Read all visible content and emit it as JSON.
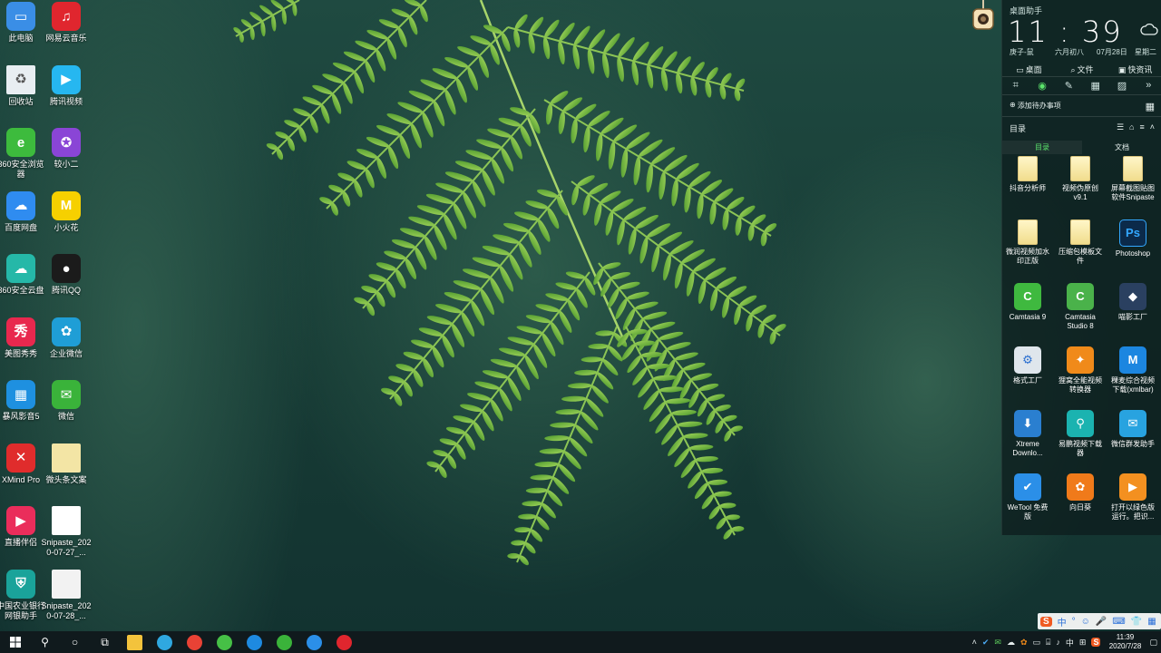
{
  "desktop": {
    "icons": [
      {
        "label": "此电脑",
        "color": "#3a8ee6",
        "glyph": "▭",
        "icon": "computer-icon"
      },
      {
        "label": "网易云音乐",
        "color": "#e0262e",
        "glyph": "♫",
        "icon": "netease-music-icon"
      },
      {
        "label": "回收站",
        "color": "#e8eef2",
        "glyph": "♻",
        "icon": "recycle-bin-icon"
      },
      {
        "label": "腾讯视频",
        "color": "#26b7f0",
        "glyph": "▶",
        "icon": "tencent-video-icon"
      },
      {
        "label": "360安全浏览器",
        "color": "#3dbb3d",
        "glyph": "e",
        "icon": "360-browser-icon"
      },
      {
        "label": "较小二",
        "color": "#8a45d6",
        "glyph": "✪",
        "icon": "jiaoxiaoer-icon"
      },
      {
        "label": "百度网盘",
        "color": "#2f8cf0",
        "glyph": "☁",
        "icon": "baidu-netdisk-icon"
      },
      {
        "label": "小火花",
        "color": "#f6d000",
        "glyph": "M",
        "icon": "xiaohuohua-icon"
      },
      {
        "label": "360安全云盘",
        "color": "#25b8a8",
        "glyph": "☁",
        "icon": "360-cloud-icon"
      },
      {
        "label": "腾讯QQ",
        "color": "#1b1b1b",
        "glyph": "●",
        "icon": "qq-icon"
      },
      {
        "label": "美图秀秀",
        "color": "#e8284e",
        "glyph": "秀",
        "icon": "meitu-icon"
      },
      {
        "label": "企业微信",
        "color": "#1f9ed6",
        "glyph": "✿",
        "icon": "wecom-icon"
      },
      {
        "label": "暴风影音5",
        "color": "#1e90e0",
        "glyph": "▦",
        "icon": "baofeng-icon"
      },
      {
        "label": "微信",
        "color": "#3ab33a",
        "glyph": "✉",
        "icon": "wechat-icon"
      },
      {
        "label": "XMind Pro",
        "color": "#e02c2c",
        "glyph": "✕",
        "icon": "xmind-icon"
      },
      {
        "label": "微头条文案",
        "color": "#f3e5a5",
        "glyph": "",
        "icon": "file-icon"
      },
      {
        "label": "直播伴侣",
        "color": "#ea2d5b",
        "glyph": "▶",
        "icon": "live-companion-icon"
      },
      {
        "label": "Snipaste_2020-07-27_...",
        "color": "#ffffff",
        "glyph": "",
        "icon": "image-file-icon"
      },
      {
        "label": "中国农业银行网银助手",
        "color": "#1aa39a",
        "glyph": "⛨",
        "icon": "abc-bank-icon"
      },
      {
        "label": "Snipaste_2020-07-28_...",
        "color": "#f2f2f2",
        "glyph": "",
        "icon": "image-file-icon"
      }
    ]
  },
  "widget": {
    "title": "桌面助手",
    "time": "11 : 39",
    "lunar_year": "庚子-鼠",
    "lunar_date": "六月初八",
    "date": "07月28日",
    "weekday": "星期二",
    "tabs": [
      {
        "label": "桌面",
        "glyph": "▭"
      },
      {
        "label": "文件",
        "glyph": "⌕"
      },
      {
        "label": "快资讯",
        "glyph": "▣"
      }
    ],
    "tools": [
      "⌗",
      "◉",
      "✎",
      "▦",
      "▨",
      "»"
    ],
    "add_todo": "添加待办事项",
    "section_title": "目录",
    "subtabs": [
      "目录",
      "文档"
    ],
    "items": [
      {
        "label": "抖音分析师",
        "type": "folder"
      },
      {
        "label": "视频伪原创v9.1",
        "type": "folder"
      },
      {
        "label": "屏幕截图贴图软件Snipaste",
        "type": "folder"
      },
      {
        "label": "微润视频加水印正版",
        "type": "folder"
      },
      {
        "label": "压缩包模板文件",
        "type": "folder"
      },
      {
        "label": "Photoshop",
        "type": "app",
        "color": "#0b2a4a",
        "glyph": "Ps"
      },
      {
        "label": "Camtasia 9",
        "type": "app",
        "color": "#3fb93f",
        "glyph": "C"
      },
      {
        "label": "Camtasia Studio 8",
        "type": "app",
        "color": "#4ab24a",
        "glyph": "C"
      },
      {
        "label": "喵影工厂",
        "type": "app",
        "color": "#2a4060",
        "glyph": "◆"
      },
      {
        "label": "格式工厂",
        "type": "app",
        "color": "#dfe6ec",
        "glyph": "⚙"
      },
      {
        "label": "狸窝全能视频转换器",
        "type": "app",
        "color": "#f08a1a",
        "glyph": "✦"
      },
      {
        "label": "稞麦综合视频下载(xmlbar)",
        "type": "app",
        "color": "#1c86e0",
        "glyph": "M"
      },
      {
        "label": "Xtreme Downlo...",
        "type": "app",
        "color": "#2a7fd0",
        "glyph": "⬇"
      },
      {
        "label": "易鹏视频下载器",
        "type": "app",
        "color": "#1bb3b0",
        "glyph": "⚲"
      },
      {
        "label": "微信群发助手",
        "type": "app",
        "color": "#28a3e0",
        "glyph": "✉"
      },
      {
        "label": "WeTool 免费版",
        "type": "app",
        "color": "#2b8fe8",
        "glyph": "✔"
      },
      {
        "label": "向日葵",
        "type": "app",
        "color": "#f07a1a",
        "glyph": "✿"
      },
      {
        "label": "打开以绿色版运行。把识...",
        "type": "app",
        "color": "#f39020",
        "glyph": "▶"
      }
    ]
  },
  "taskbar": {
    "apps": [
      {
        "icon": "file-explorer-icon",
        "color": "#f3c33c"
      },
      {
        "icon": "edge-browser-icon",
        "color": "#2fa8e0"
      },
      {
        "icon": "chrome-icon",
        "color": "#e94235"
      },
      {
        "icon": "360-browser-icon",
        "color": "#46c046"
      },
      {
        "icon": "qq-browser-icon",
        "color": "#1e8ae0"
      },
      {
        "icon": "wechat-icon",
        "color": "#3ab33a"
      },
      {
        "icon": "wetool-icon",
        "color": "#2b8fe8"
      },
      {
        "icon": "netease-music-icon",
        "color": "#e0262e"
      }
    ],
    "ime_label": "中",
    "clock_time": "11:39",
    "clock_date": "2020/7/28"
  },
  "ime_toolbar": {
    "items": [
      "S",
      "中",
      "°",
      "☺",
      "🎤",
      "⌨",
      "👕",
      "▦"
    ]
  }
}
